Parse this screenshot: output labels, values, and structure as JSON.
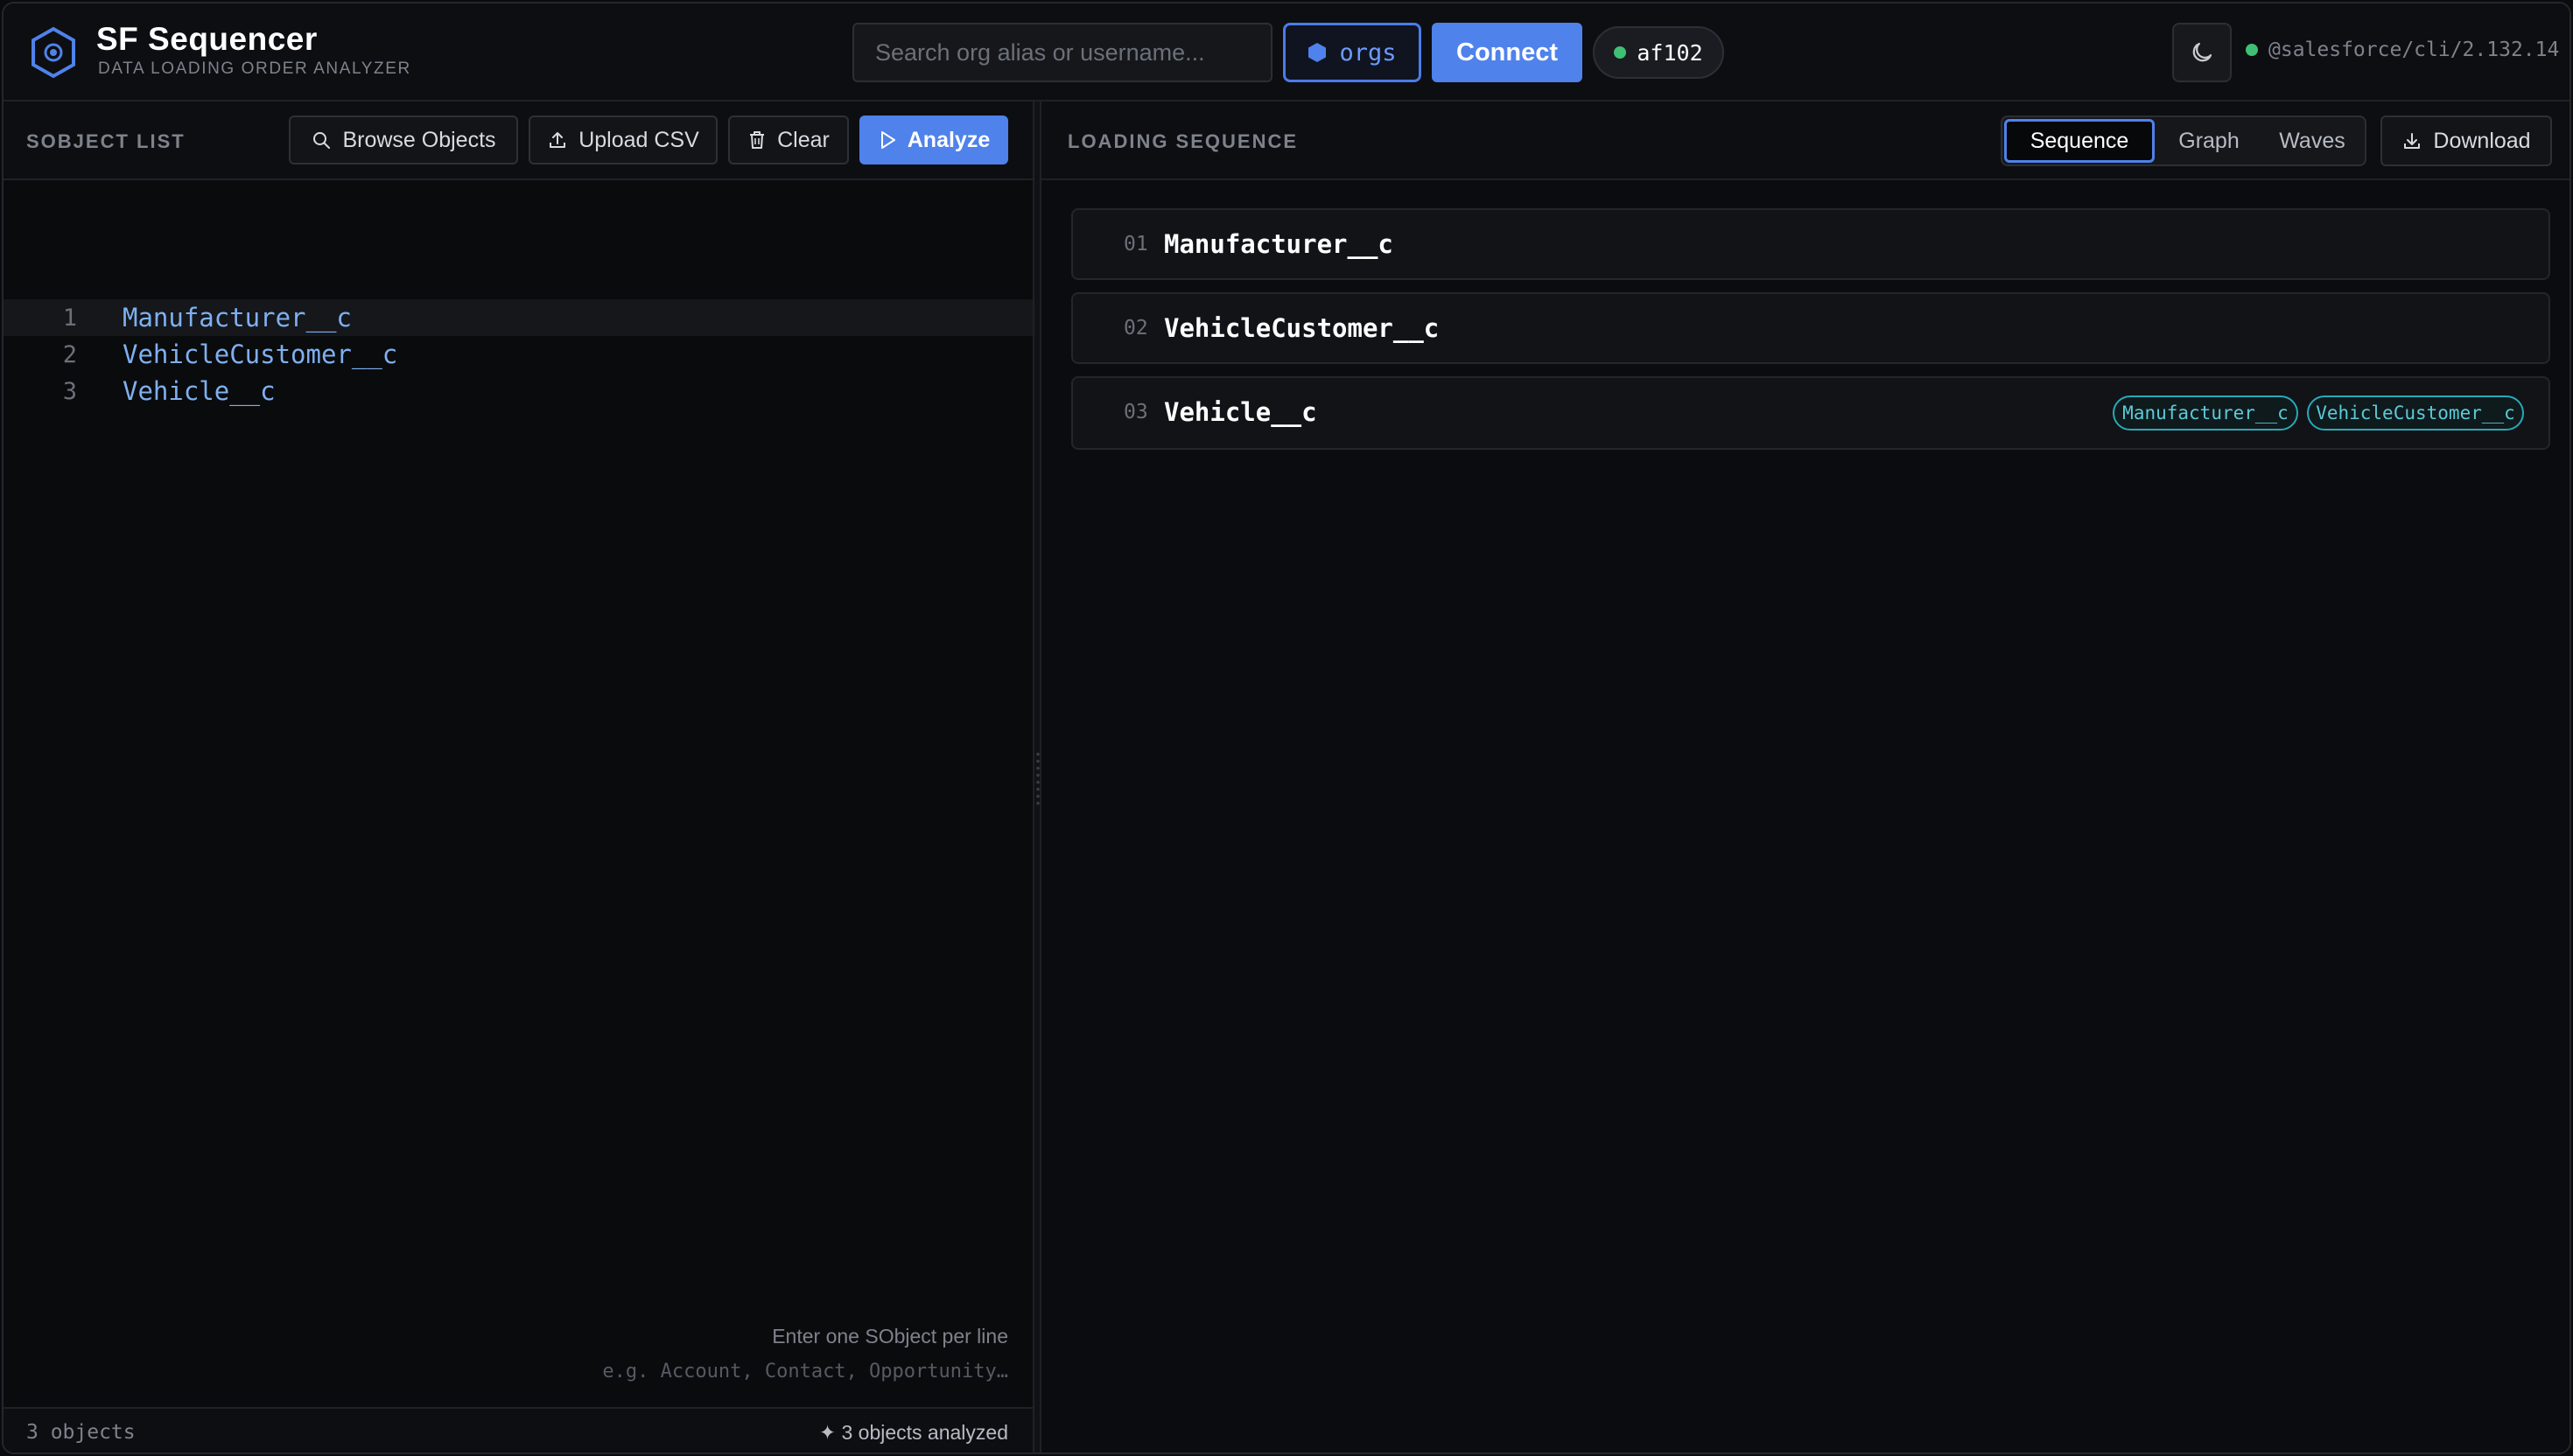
{
  "app": {
    "title": "SF Sequencer",
    "subtitle": "DATA LOADING ORDER ANALYZER"
  },
  "header": {
    "search_placeholder": "Search org alias or username...",
    "orgs_label": "orgs",
    "connect_label": "Connect",
    "org_alias": "af102",
    "cli_version": "@salesforce/cli/2.132.14"
  },
  "left_panel": {
    "label": "SOBJECT LIST",
    "buttons": {
      "browse": "Browse Objects",
      "upload": "Upload CSV",
      "clear": "Clear",
      "analyze": "Analyze"
    },
    "lines": [
      {
        "no": "1",
        "text": "Manufacturer__c"
      },
      {
        "no": "2",
        "text": "VehicleCustomer__c"
      },
      {
        "no": "3",
        "text": "Vehicle__c"
      }
    ],
    "hint": "Enter one SObject per line",
    "example": "e.g. Account, Contact, Opportunity…",
    "footer_count": "3 objects",
    "footer_status": "✦ 3 objects analyzed"
  },
  "right_panel": {
    "label": "LOADING SEQUENCE",
    "tabs": [
      "Sequence",
      "Graph",
      "Waves"
    ],
    "active_tab": "Sequence",
    "download_label": "Download",
    "sequence": [
      {
        "num": "01",
        "name": "Manufacturer__c",
        "deps": []
      },
      {
        "num": "02",
        "name": "VehicleCustomer__c",
        "deps": []
      },
      {
        "num": "03",
        "name": "Vehicle__c",
        "deps": [
          "Manufacturer__c",
          "VehicleCustomer__c"
        ]
      }
    ]
  },
  "colors": {
    "accent": "#4f82ea",
    "status_green": "#3fbf73",
    "dependency_tag": "#5ccad7"
  }
}
